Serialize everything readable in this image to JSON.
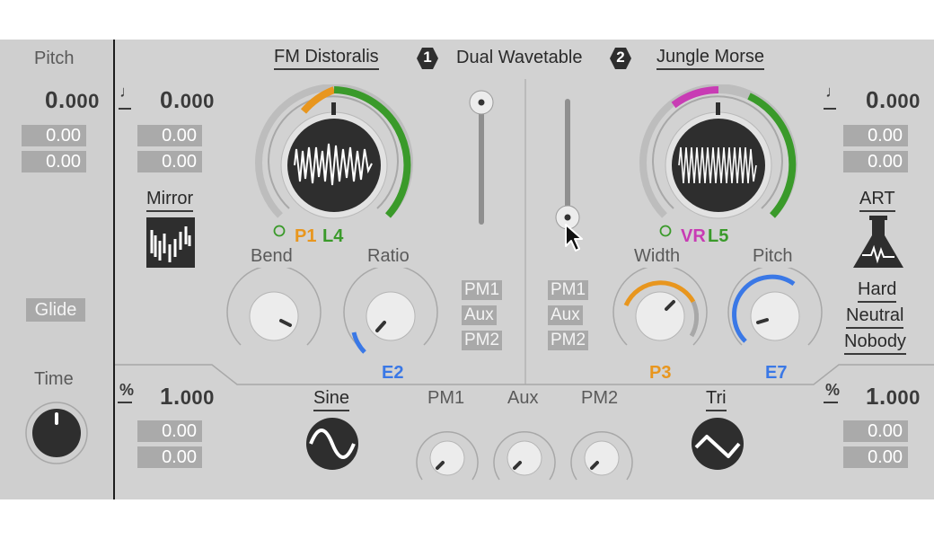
{
  "left": {
    "pitch_label": "Pitch",
    "pitch_value_int": "0.",
    "pitch_value_dec": "000",
    "pitch_box1": "0.00",
    "pitch_box2": "0.00",
    "glide_label": "Glide",
    "time_label": "Time"
  },
  "header": {
    "osc1_name": "FM Distoralis",
    "badge1": "1",
    "center_name": "Dual Wavetable",
    "badge2": "2",
    "osc2_name": "Jungle Morse"
  },
  "osc1": {
    "note_icon": "♩",
    "value_int": "0.",
    "value_dec": "000",
    "box1": "0.00",
    "box2": "0.00",
    "mode_label": "Mirror",
    "p_label": "P1",
    "l_label": "L4",
    "bend_label": "Bend",
    "ratio_label": "Ratio",
    "ratio_mod": "E2",
    "level_icon": "%",
    "level_int": "1.",
    "level_dec": "000",
    "level_box1": "0.00",
    "level_box2": "0.00"
  },
  "osc2": {
    "note_icon": "♩",
    "value_int": "0.",
    "value_dec": "000",
    "box1": "0.00",
    "box2": "0.00",
    "mode_label": "ART",
    "opt1": "Hard",
    "opt2": "Neutral",
    "opt3": "Nobody",
    "vr_label": "VR",
    "l_label": "L5",
    "width_label": "Width",
    "pitch_label": "Pitch",
    "width_mod": "P3",
    "pitch_mod": "E7",
    "level_icon": "%",
    "level_int": "1.",
    "level_dec": "000",
    "level_box1": "0.00",
    "level_box2": "0.00"
  },
  "routing": {
    "left": [
      "PM1",
      "Aux",
      "PM2"
    ],
    "right": [
      "PM1",
      "Aux",
      "PM2"
    ]
  },
  "bottom": {
    "wave1": "Sine",
    "pm1": "PM1",
    "aux": "Aux",
    "pm2": "PM2",
    "wave2": "Tri"
  },
  "colors": {
    "orange": "#e8961e",
    "green": "#3a9a2a",
    "magenta": "#c83cb4",
    "blue": "#3a78e6",
    "dark": "#2e2e2e"
  }
}
